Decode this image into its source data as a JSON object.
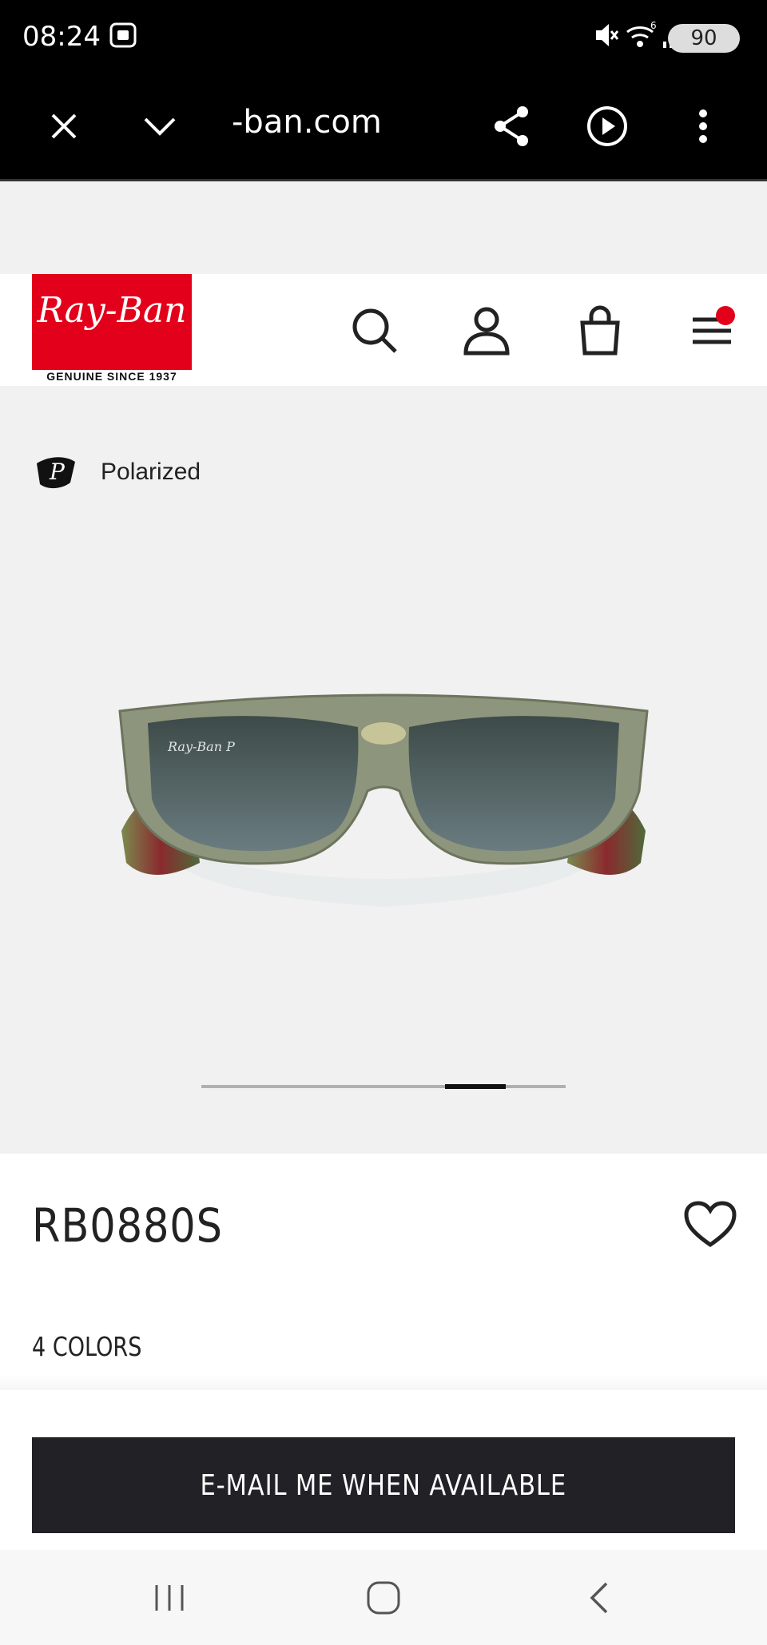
{
  "status_bar": {
    "time": "08:24",
    "battery": "90",
    "icons": [
      "screenshot-icon",
      "mute-icon",
      "wifi-icon",
      "signal-icon",
      "battery-icon"
    ]
  },
  "browser": {
    "url": "-ban.com",
    "buttons": [
      "close-icon",
      "chevron-down-icon",
      "share-icon",
      "play-icon",
      "more-icon"
    ]
  },
  "header": {
    "logo_text": "Ray-Ban",
    "logo_subtitle": "GENUINE SINCE 1937",
    "icons": [
      "search-icon",
      "account-icon",
      "bag-icon",
      "menu-icon"
    ],
    "menu_badge_color": "#e2001a"
  },
  "product": {
    "badge_label": "Polarized",
    "title": "RB0880S",
    "colors_label": "4 COLORS",
    "gallery_position": 0.75
  },
  "cta": {
    "label": "E-MAIL ME WHEN AVAILABLE"
  },
  "colors": {
    "brand_red": "#e2001a",
    "cta_bg": "#222226"
  }
}
